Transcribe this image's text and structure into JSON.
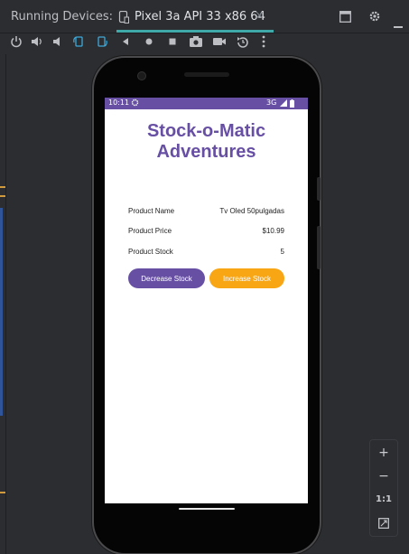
{
  "ide": {
    "panel_title": "Running Devices:",
    "tab": {
      "label": "Pixel 3a API 33 x86 64",
      "close": "×"
    }
  },
  "toolbar": {
    "icons": [
      "power-icon",
      "volume-up-icon",
      "volume-down-icon",
      "rotate-left-icon",
      "rotate-right-icon",
      "back-icon",
      "home-icon",
      "overview-icon",
      "screenshot-icon",
      "screen-record-icon",
      "snapshot-icon",
      "more-icon"
    ]
  },
  "device": {
    "status": {
      "time": "10:11",
      "network": "3G"
    },
    "app": {
      "title": "Stock-o-Matic Adventures",
      "product_name_label": "Product Name",
      "product_name_value": "Tv Oled 50pulgadas",
      "product_price_label": "Product Price",
      "product_price_value": "$10.99",
      "product_stock_label": "Product Stock",
      "product_stock_value": "5",
      "decrease_button": "Decrease Stock",
      "increase_button": "Increase Stock"
    }
  },
  "zoom": {
    "zoom_in": "+",
    "zoom_out": "−",
    "actual_size": "1:1"
  },
  "colors": {
    "accent": "#6750a4",
    "increase": "#f8a614",
    "tab_underline": "#3fa8a8"
  }
}
